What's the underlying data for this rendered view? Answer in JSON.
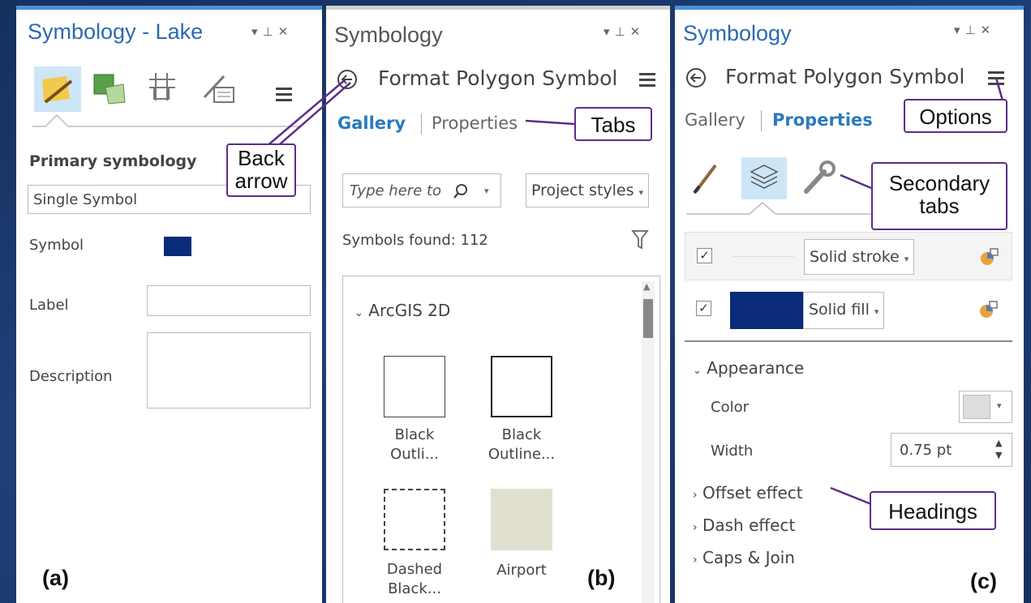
{
  "panel_a": {
    "title": "Symbology - Lake",
    "win_controls": "▾ ⊞ ✕",
    "primary_heading": "Primary symbology",
    "renderer_value": "Single Symbol",
    "symbol_label": "Symbol",
    "label_label": "Label",
    "description_label": "Description",
    "letter": "(a)",
    "symbol_color": "#0a2a7a"
  },
  "panel_b": {
    "title": "Symbology",
    "back_title": "Format Polygon Symbol",
    "tab_gallery": "Gallery",
    "tab_properties": "Properties",
    "search_placeholder": "Type here to search",
    "style_dropdown": "Project styles",
    "symbols_found": "Symbols found: 112",
    "group_label": "ArcGIS 2D",
    "symbols": [
      {
        "line1": "Black",
        "line2": "Outli..."
      },
      {
        "line1": "Black",
        "line2": "Outline..."
      },
      {
        "line1": "Dashed",
        "line2": "Black..."
      },
      {
        "line1": "Airport",
        "line2": ""
      }
    ],
    "letter": "(b)"
  },
  "panel_c": {
    "title": "Symbology",
    "back_title": "Format Polygon Symbol",
    "tab_gallery": "Gallery",
    "tab_properties": "Properties",
    "layer_stroke": "Solid stroke",
    "layer_fill": "Solid fill",
    "appearance": "Appearance",
    "color_label": "Color",
    "width_label": "Width",
    "width_value": "0.75 pt",
    "offset_effect": "Offset effect",
    "dash_effect": "Dash effect",
    "caps_join": "Caps & Join",
    "letter": "(c)",
    "fill_color": "#0a2a7a"
  },
  "callouts": {
    "back_arrow_1": "Back",
    "back_arrow_2": "arrow",
    "tabs": "Tabs",
    "options": "Options",
    "secondary_1": "Secondary",
    "secondary_2": "tabs",
    "headings": "Headings"
  }
}
